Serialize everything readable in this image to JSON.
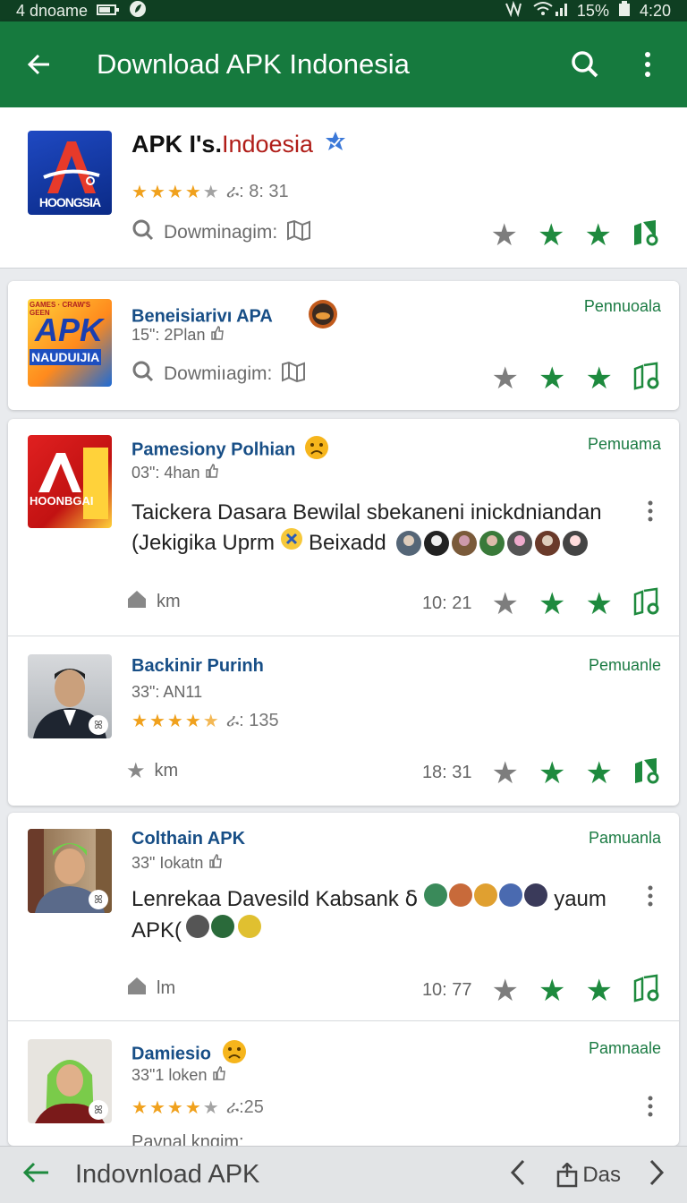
{
  "status_bar": {
    "left_text": "4 dnoame",
    "battery_text": "15%",
    "time": "4:20"
  },
  "app_bar": {
    "title": "Download APK Indonesia"
  },
  "main_app": {
    "title_black": "APK I's.",
    "title_red": "Indoesia",
    "logo_text": "HOONGSIA",
    "rating_text": "ራ: 8: 31",
    "download_label": "Dowminagim:"
  },
  "cards": [
    {
      "name": "Beneisiarivı APA",
      "meta": "15\": 2Plan",
      "tag": "Pennuoala",
      "download_label": "Dowmiıagim:",
      "thumb_top": "GAMES · CRAW'S GEEN",
      "thumb_big": "APK",
      "thumb_mid": "NAUDUIJIA"
    },
    {
      "name": "Pamesiony Polhian",
      "meta": "03\": 4han",
      "tag": "Pemuama",
      "body_line1": "Taickera Dasara Bewilal sbekaneni inickdniandan",
      "body_line2_a": "(Jekigika Uprm",
      "body_line2_b": "Beixadd",
      "home_label": "km",
      "time": "10: 21",
      "logo_text": "HOONBGAI"
    },
    {
      "name": "Backinir Purinh",
      "meta": "33\": AN11",
      "tag": "Pemuanle",
      "rating_text": "ራ: 135",
      "home_label": "km",
      "time": "18: 31"
    },
    {
      "name": "Colthain  APK",
      "meta": "33\" Iokatn",
      "tag": "Pamuanla",
      "body_line1": "Lenrekaa Davesild Kabsank ẟ",
      "body_line1_b": "yaum",
      "body_line2": "APK(",
      "home_label": "lm",
      "time": "10: 77"
    },
    {
      "name": "Damiesio",
      "meta": "33\"1 loken",
      "tag": "Pamnaale",
      "rating_text": "ራ:25",
      "peek_text": "Pavnal knqim:"
    }
  ],
  "bottom_bar": {
    "label": "Indovnload APK",
    "page_label": "Das"
  },
  "colors": {
    "appbar": "#167a3e",
    "statusbar": "#0f3f22",
    "accent_green": "#1e8a3e",
    "name_blue": "#174e86",
    "star_gold": "#f0a11d"
  }
}
